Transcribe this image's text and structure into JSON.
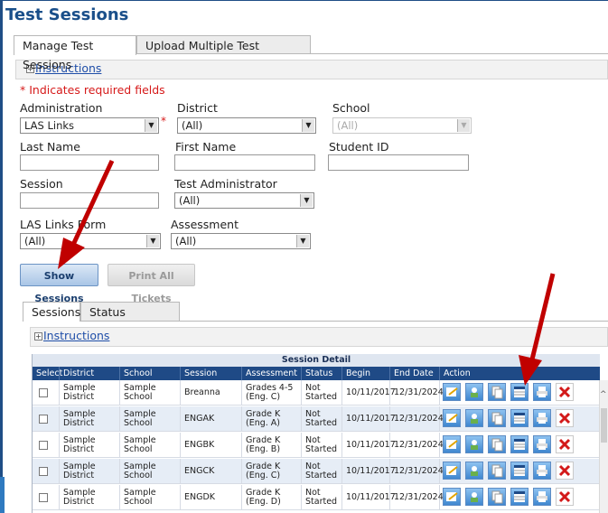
{
  "page": {
    "title": "Test Sessions"
  },
  "top_tabs": [
    {
      "label": "Manage Test Sessions",
      "active": true
    },
    {
      "label": "Upload Multiple Test Sessions",
      "active": false
    }
  ],
  "instructions_label": "Instructions",
  "required_note": "* Indicates required fields",
  "form": {
    "administration": {
      "label": "Administration",
      "value": "LAS Links",
      "required": "*"
    },
    "district": {
      "label": "District",
      "value": "(All)"
    },
    "school": {
      "label": "School",
      "value": "(All)"
    },
    "last_name": {
      "label": "Last Name",
      "value": ""
    },
    "first_name": {
      "label": "First Name",
      "value": ""
    },
    "student_id": {
      "label": "Student ID",
      "value": ""
    },
    "session": {
      "label": "Session",
      "value": ""
    },
    "test_administrator": {
      "label": "Test Administrator",
      "value": "(All)"
    },
    "las_links_form": {
      "label": "LAS Links Form",
      "value": "(All)"
    },
    "assessment": {
      "label": "Assessment",
      "value": "(All)"
    }
  },
  "buttons": {
    "show_sessions": "Show Sessions",
    "print_all_tickets": "Print All Tickets"
  },
  "sub_tabs": [
    {
      "label": "Sessions",
      "active": true
    },
    {
      "label": "Status Summary",
      "active": false
    }
  ],
  "grid": {
    "title": "Session Detail",
    "columns": [
      "Select",
      "District",
      "School",
      "Session Name",
      "Assessment",
      "Status",
      "Begin Date",
      "End Date",
      "Action"
    ],
    "rows": [
      {
        "district": "Sample District",
        "school": "Sample School",
        "session": "Breanna",
        "assessment": "Grades 4-5 (Eng. C)",
        "status": "Not Started",
        "begin": "10/11/2017",
        "end": "12/31/2024"
      },
      {
        "district": "Sample District",
        "school": "Sample School",
        "session": "ENGAK",
        "assessment": "Grade K (Eng. A)",
        "status": "Not Started",
        "begin": "10/11/2017",
        "end": "12/31/2024"
      },
      {
        "district": "Sample District",
        "school": "Sample School",
        "session": "ENGBK",
        "assessment": "Grade K (Eng. B)",
        "status": "Not Started",
        "begin": "10/11/2017",
        "end": "12/31/2024"
      },
      {
        "district": "Sample District",
        "school": "Sample School",
        "session": "ENGCK",
        "assessment": "Grade K (Eng. C)",
        "status": "Not Started",
        "begin": "10/11/2017",
        "end": "12/31/2024"
      },
      {
        "district": "Sample District",
        "school": "Sample School",
        "session": "ENGDK",
        "assessment": "Grade K (Eng. D)",
        "status": "Not Started",
        "begin": "10/11/2017",
        "end": "12/31/2024"
      }
    ],
    "action_icons": [
      "edit-session-icon",
      "roster-icon",
      "copy-session-icon",
      "grid-view-icon",
      "print-icon",
      "delete-icon"
    ]
  },
  "colors": {
    "title": "#1a4f8a",
    "header": "#1f4a86",
    "required": "#d61a1a",
    "arrow": "#c00000"
  }
}
